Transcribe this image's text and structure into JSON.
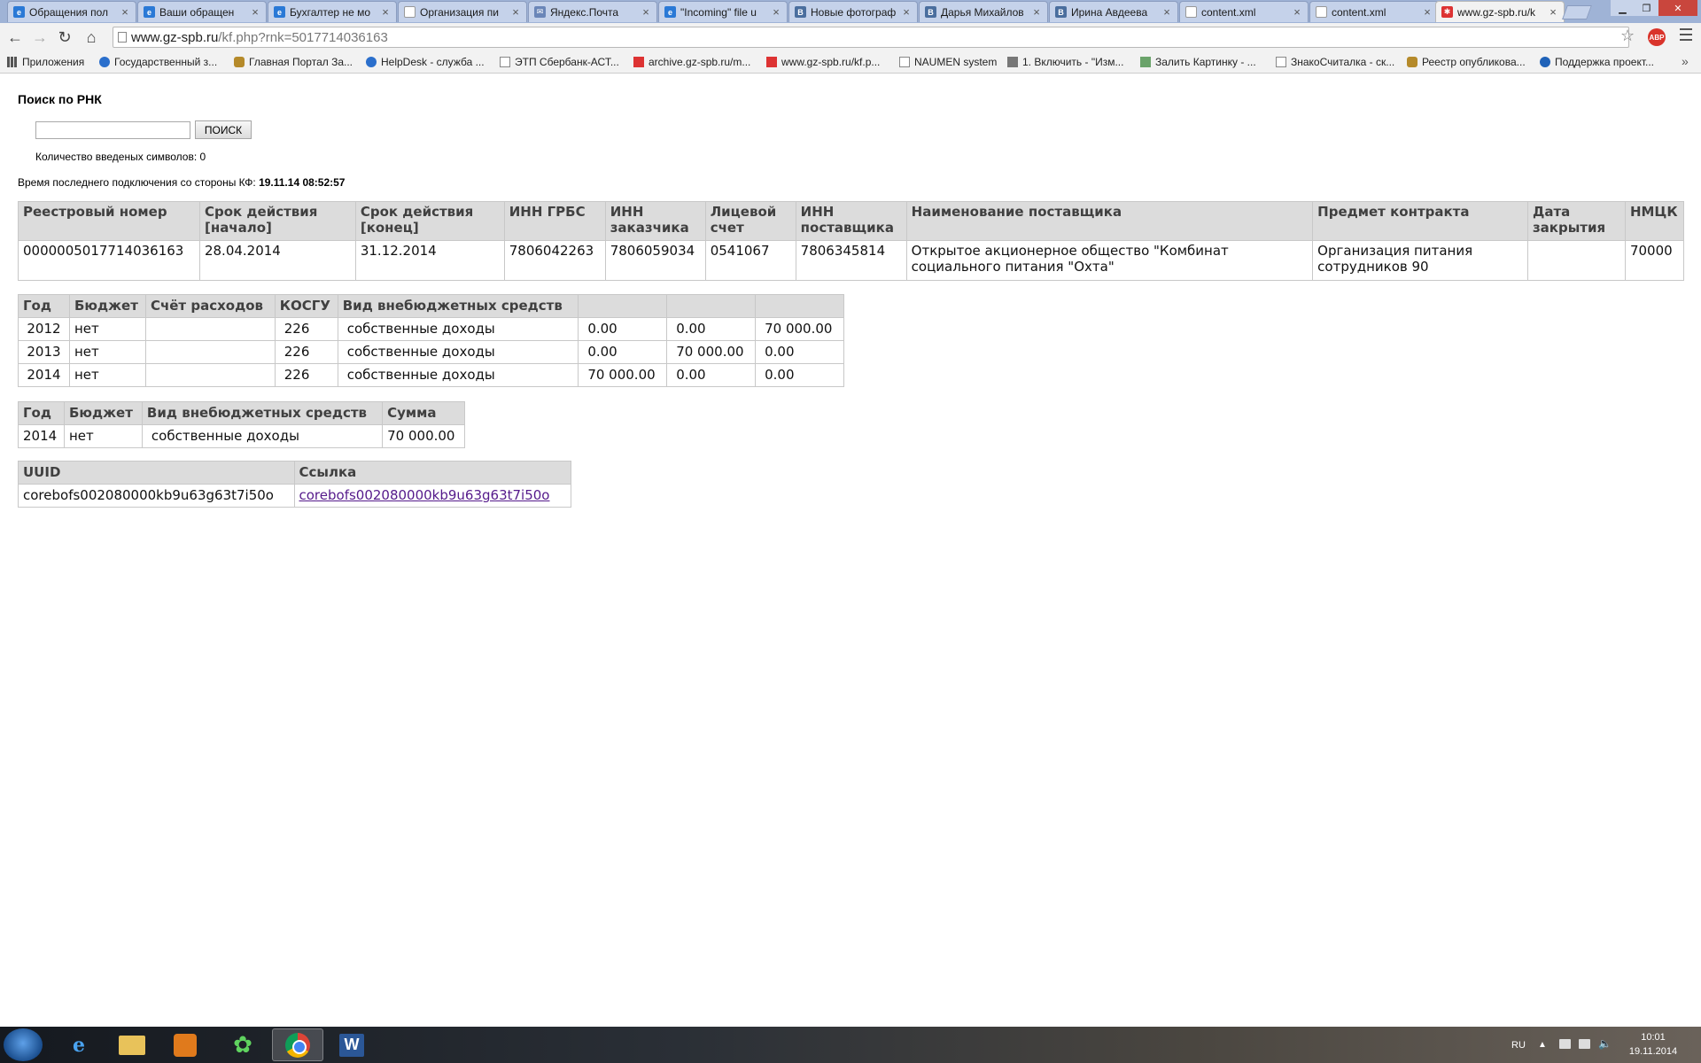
{
  "browser": {
    "tabs": [
      {
        "label": "Обращения пол",
        "icon": "ie-globe-icon"
      },
      {
        "label": "Ваши обращен",
        "icon": "ie-globe-icon"
      },
      {
        "label": "Бухгалтер не мо",
        "icon": "ie-globe-icon"
      },
      {
        "label": "Организация пи",
        "icon": "document-icon"
      },
      {
        "label": "Яндекс.Почта",
        "icon": "mail-icon"
      },
      {
        "label": "\"Incoming\" file u",
        "icon": "ie-globe-icon"
      },
      {
        "label": "Новые фотограф",
        "icon": "vk-icon"
      },
      {
        "label": "Дарья Михайлов",
        "icon": "vk-icon"
      },
      {
        "label": "Ирина Авдеева",
        "icon": "vk-icon"
      },
      {
        "label": "content.xml",
        "icon": "document-icon"
      },
      {
        "label": "content.xml",
        "icon": "document-icon"
      },
      {
        "label": "www.gz-spb.ru/k",
        "icon": "gz-spb-icon",
        "active": true
      }
    ],
    "url": {
      "host": "www.gz-spb.ru",
      "path": "/kf.php?rnk=5017714036163"
    },
    "extension_label": "ABP",
    "bookmarks": [
      {
        "label": "Приложения",
        "icon": "apps-icon"
      },
      {
        "label": "Государственный з...",
        "icon": "globe-icon"
      },
      {
        "label": "Главная Портал За...",
        "icon": "crest-icon"
      },
      {
        "label": "HelpDesk - служба ...",
        "icon": "globe-icon"
      },
      {
        "label": "ЭТП Сбербанк-АСТ...",
        "icon": "page-icon"
      },
      {
        "label": "archive.gz-spb.ru/m...",
        "icon": "gz-spb-icon"
      },
      {
        "label": "www.gz-spb.ru/kf.p...",
        "icon": "gz-spb-icon"
      },
      {
        "label": "NAUMEN system",
        "icon": "page-icon"
      },
      {
        "label": "1. Включить - \"Изм...",
        "icon": "video-icon"
      },
      {
        "label": "Залить Картинку - ...",
        "icon": "image-icon"
      },
      {
        "label": "ЗнакоСчиталка - ск...",
        "icon": "page-icon"
      },
      {
        "label": "Реестр опубликова...",
        "icon": "crest-icon"
      },
      {
        "label": "Поддержка проект...",
        "icon": "edge-icon"
      }
    ]
  },
  "page": {
    "heading": "Поиск по РНК",
    "search": {
      "value": "",
      "button_label": "ПОИСК"
    },
    "char_count_label": "Количество введеных символов: 0",
    "last_connection": {
      "label": "Время последнего подключения со стороны КФ:",
      "value": "19.11.14 08:52:57"
    },
    "contract_table": {
      "headers": [
        "Реестровый номер",
        "Срок действия [начало]",
        "Срок действия [конец]",
        "ИНН ГРБС",
        "ИНН заказчика",
        "Лицевой счет",
        "ИНН поставщика",
        "Наименование поставщика",
        "Предмет контракта",
        "Дата закрытия",
        "НМЦК"
      ],
      "row": [
        "0000005017714036163",
        "28.04.2014",
        "31.12.2014",
        "7806042263",
        "7806059034",
        "0541067",
        "7806345814",
        "Открытое акционерное общество \"Комбинат социального питания \"Охта\"",
        "Организация питания сотрудников 90",
        "",
        "70000"
      ]
    },
    "years_table": {
      "headers": [
        "Год",
        "Бюджет",
        "Счёт расходов",
        "КОСГУ",
        "Вид внебюджетных средств",
        "",
        "",
        ""
      ],
      "rows": [
        [
          "2012",
          "нет",
          "",
          "226",
          "собственные доходы",
          "0.00",
          "0.00",
          "70 000.00"
        ],
        [
          "2013",
          "нет",
          "",
          "226",
          "собственные доходы",
          "0.00",
          "70 000.00",
          "0.00"
        ],
        [
          "2014",
          "нет",
          "",
          "226",
          "собственные доходы",
          "70 000.00",
          "0.00",
          "0.00"
        ]
      ]
    },
    "sum_table": {
      "headers": [
        "Год",
        "Бюджет",
        "Вид внебюджетных средств",
        "Сумма"
      ],
      "rows": [
        [
          "2014",
          "нет",
          "собственные доходы",
          "70 000.00"
        ]
      ]
    },
    "uuid_table": {
      "headers": [
        "UUID",
        "Ссылка"
      ],
      "rows": [
        [
          "corebofs002080000kb9u63g63t7i50o",
          "corebofs002080000kb9u63g63t7i50o"
        ]
      ]
    }
  },
  "taskbar": {
    "apps": [
      "start-orb-icon",
      "internet-explorer-icon",
      "file-explorer-icon",
      "media-player-icon",
      "icq-icon",
      "chrome-icon",
      "word-icon"
    ],
    "language": "RU",
    "time": "10:01",
    "date": "19.11.2014"
  }
}
